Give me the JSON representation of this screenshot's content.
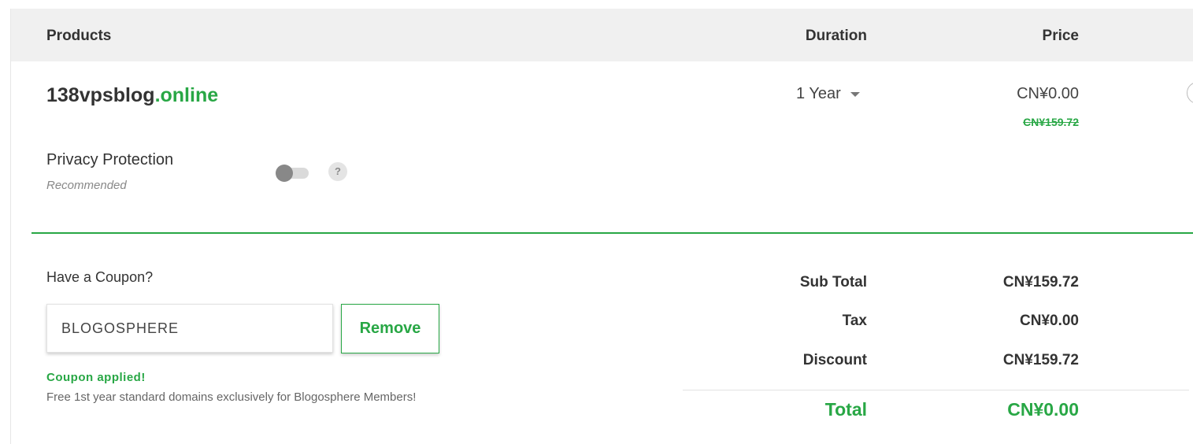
{
  "header": {
    "products": "Products",
    "duration": "Duration",
    "price": "Price"
  },
  "item": {
    "domain_name": "138vpsblog",
    "domain_tld": ".online",
    "duration": "1 Year",
    "price": "CN¥0.00",
    "original_price": "CN¥159.72"
  },
  "privacy": {
    "label": "Privacy Protection",
    "note": "Recommended",
    "enabled": false,
    "help": "?"
  },
  "coupon": {
    "title": "Have a Coupon?",
    "code": "BLOGOSPHERE",
    "remove_label": "Remove",
    "status": "Coupon applied!",
    "description": "Free 1st year standard domains exclusively for Blogosphere Members!"
  },
  "summary": {
    "subtotal_label": "Sub Total",
    "subtotal_value": "CN¥159.72",
    "tax_label": "Tax",
    "tax_value": "CN¥0.00",
    "discount_label": "Discount",
    "discount_value": "CN¥159.72",
    "total_label": "Total",
    "total_value": "CN¥0.00"
  },
  "colors": {
    "accent": "#28a745",
    "header_bg": "#f0f0f0",
    "text": "#333333"
  }
}
